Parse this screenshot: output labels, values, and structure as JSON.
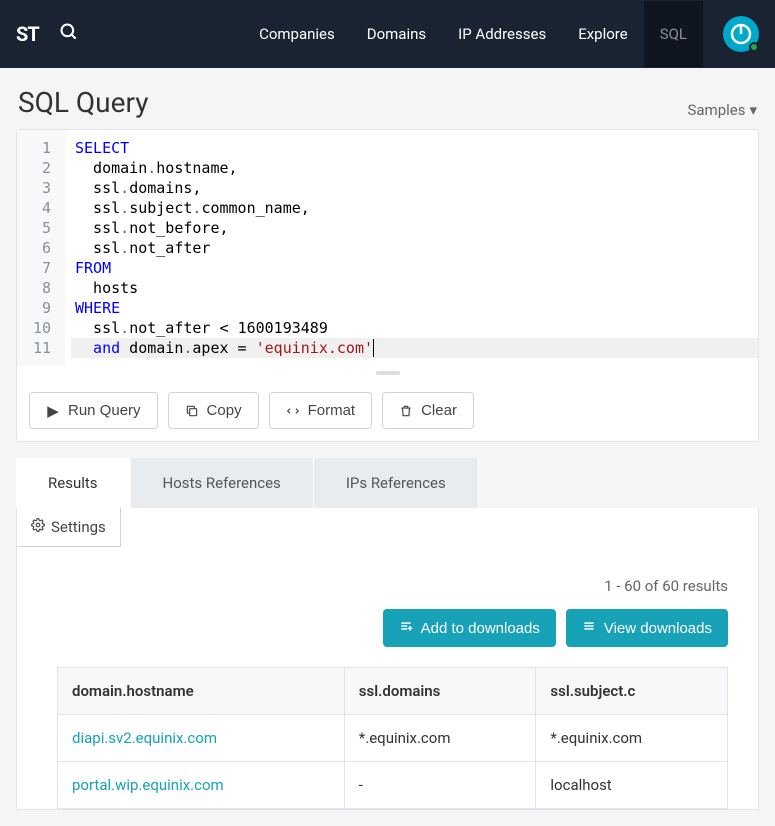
{
  "nav": {
    "logo": "ST",
    "items": [
      {
        "label": "Companies",
        "active": false
      },
      {
        "label": "Domains",
        "active": false
      },
      {
        "label": "IP Addresses",
        "active": false
      },
      {
        "label": "Explore",
        "active": false
      },
      {
        "label": "SQL",
        "active": true
      }
    ]
  },
  "page": {
    "title": "SQL Query",
    "samples_label": "Samples"
  },
  "query": {
    "lines": [
      {
        "n": 1,
        "tokens": [
          {
            "t": "SELECT",
            "c": "kw"
          }
        ]
      },
      {
        "n": 2,
        "tokens": [
          {
            "t": "  domain",
            "c": "prop"
          },
          {
            "t": ".",
            "c": "dot"
          },
          {
            "t": "hostname",
            "c": "prop"
          },
          {
            "t": ",",
            "c": "op"
          }
        ]
      },
      {
        "n": 3,
        "tokens": [
          {
            "t": "  ssl",
            "c": "prop"
          },
          {
            "t": ".",
            "c": "dot"
          },
          {
            "t": "domains",
            "c": "prop"
          },
          {
            "t": ",",
            "c": "op"
          }
        ]
      },
      {
        "n": 4,
        "tokens": [
          {
            "t": "  ssl",
            "c": "prop"
          },
          {
            "t": ".",
            "c": "dot"
          },
          {
            "t": "subject",
            "c": "prop"
          },
          {
            "t": ".",
            "c": "dot"
          },
          {
            "t": "common_name",
            "c": "prop"
          },
          {
            "t": ",",
            "c": "op"
          }
        ]
      },
      {
        "n": 5,
        "tokens": [
          {
            "t": "  ssl",
            "c": "prop"
          },
          {
            "t": ".",
            "c": "dot"
          },
          {
            "t": "not_before",
            "c": "prop"
          },
          {
            "t": ",",
            "c": "op"
          }
        ]
      },
      {
        "n": 6,
        "tokens": [
          {
            "t": "  ssl",
            "c": "prop"
          },
          {
            "t": ".",
            "c": "dot"
          },
          {
            "t": "not_after",
            "c": "prop"
          }
        ]
      },
      {
        "n": 7,
        "tokens": [
          {
            "t": "FROM",
            "c": "kw"
          }
        ]
      },
      {
        "n": 8,
        "tokens": [
          {
            "t": "  hosts",
            "c": "prop"
          }
        ]
      },
      {
        "n": 9,
        "tokens": [
          {
            "t": "WHERE",
            "c": "kw"
          }
        ]
      },
      {
        "n": 10,
        "tokens": [
          {
            "t": "  ssl",
            "c": "prop"
          },
          {
            "t": ".",
            "c": "dot"
          },
          {
            "t": "not_after",
            "c": "prop"
          },
          {
            "t": " < ",
            "c": "op"
          },
          {
            "t": "1600193489",
            "c": "num"
          }
        ]
      },
      {
        "n": 11,
        "tokens": [
          {
            "t": "  and",
            "c": "kw"
          },
          {
            "t": " domain",
            "c": "prop"
          },
          {
            "t": ".",
            "c": "dot"
          },
          {
            "t": "apex",
            "c": "prop"
          },
          {
            "t": " = ",
            "c": "op"
          },
          {
            "t": "'equinix.com'",
            "c": "str"
          }
        ],
        "highlight": true,
        "cursor_after": true
      }
    ]
  },
  "toolbar": {
    "run_label": "Run Query",
    "copy_label": "Copy",
    "format_label": "Format",
    "clear_label": "Clear"
  },
  "tabs": [
    {
      "label": "Results",
      "active": true
    },
    {
      "label": "Hosts References",
      "active": false
    },
    {
      "label": "IPs References",
      "active": false
    }
  ],
  "results": {
    "settings_label": "Settings",
    "count_text": "1 - 60 of 60 results",
    "add_downloads_label": "Add to downloads",
    "view_downloads_label": "View downloads",
    "columns": [
      "domain.hostname",
      "ssl.domains",
      "ssl.subject.common_name"
    ],
    "column_display": [
      "domain.hostname",
      "ssl.domains",
      "ssl.subject.c"
    ],
    "rows": [
      {
        "hostname": "diapi.sv2.equinix.com",
        "ssl_domains": "*.equinix.com",
        "common_name": "*.equinix.com"
      },
      {
        "hostname": "portal.wip.equinix.com",
        "ssl_domains": "-",
        "common_name": "localhost"
      }
    ]
  }
}
